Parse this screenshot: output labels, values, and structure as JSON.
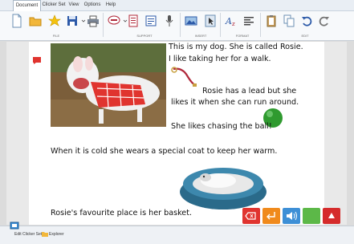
{
  "menu": {
    "tabs": [
      {
        "label": "Document",
        "active": true
      },
      {
        "label": "Clicker Set",
        "active": false
      },
      {
        "label": "View",
        "active": false
      },
      {
        "label": "Options",
        "active": false
      },
      {
        "label": "Help",
        "active": false
      }
    ]
  },
  "ribbon": {
    "groups": {
      "file": "FILE",
      "support": "SUPPORT",
      "insert": "INSERT",
      "format": "FORMAT",
      "edit": "EDIT"
    }
  },
  "document": {
    "lines": {
      "l1": "This is my dog. She is called Rosie.",
      "l2": "I like taking her for a walk.",
      "l3": "Rosie has a lead but she",
      "l4": "likes it when she can run around.",
      "l5": "She likes chasing the ball!",
      "l6": "When it is cold she wears  a special coat to keep her warm.",
      "l7": "Rosie's favourite place is her basket."
    }
  },
  "statusbar": {
    "edit_clicker_set": "Edit Clicker Set",
    "explorer": "Explorer"
  },
  "colors": {
    "accent_red": "#e0342f",
    "orange": "#f08a1c",
    "blue": "#3d8fd6",
    "green": "#5cb848",
    "dark_red": "#d52b2b"
  }
}
